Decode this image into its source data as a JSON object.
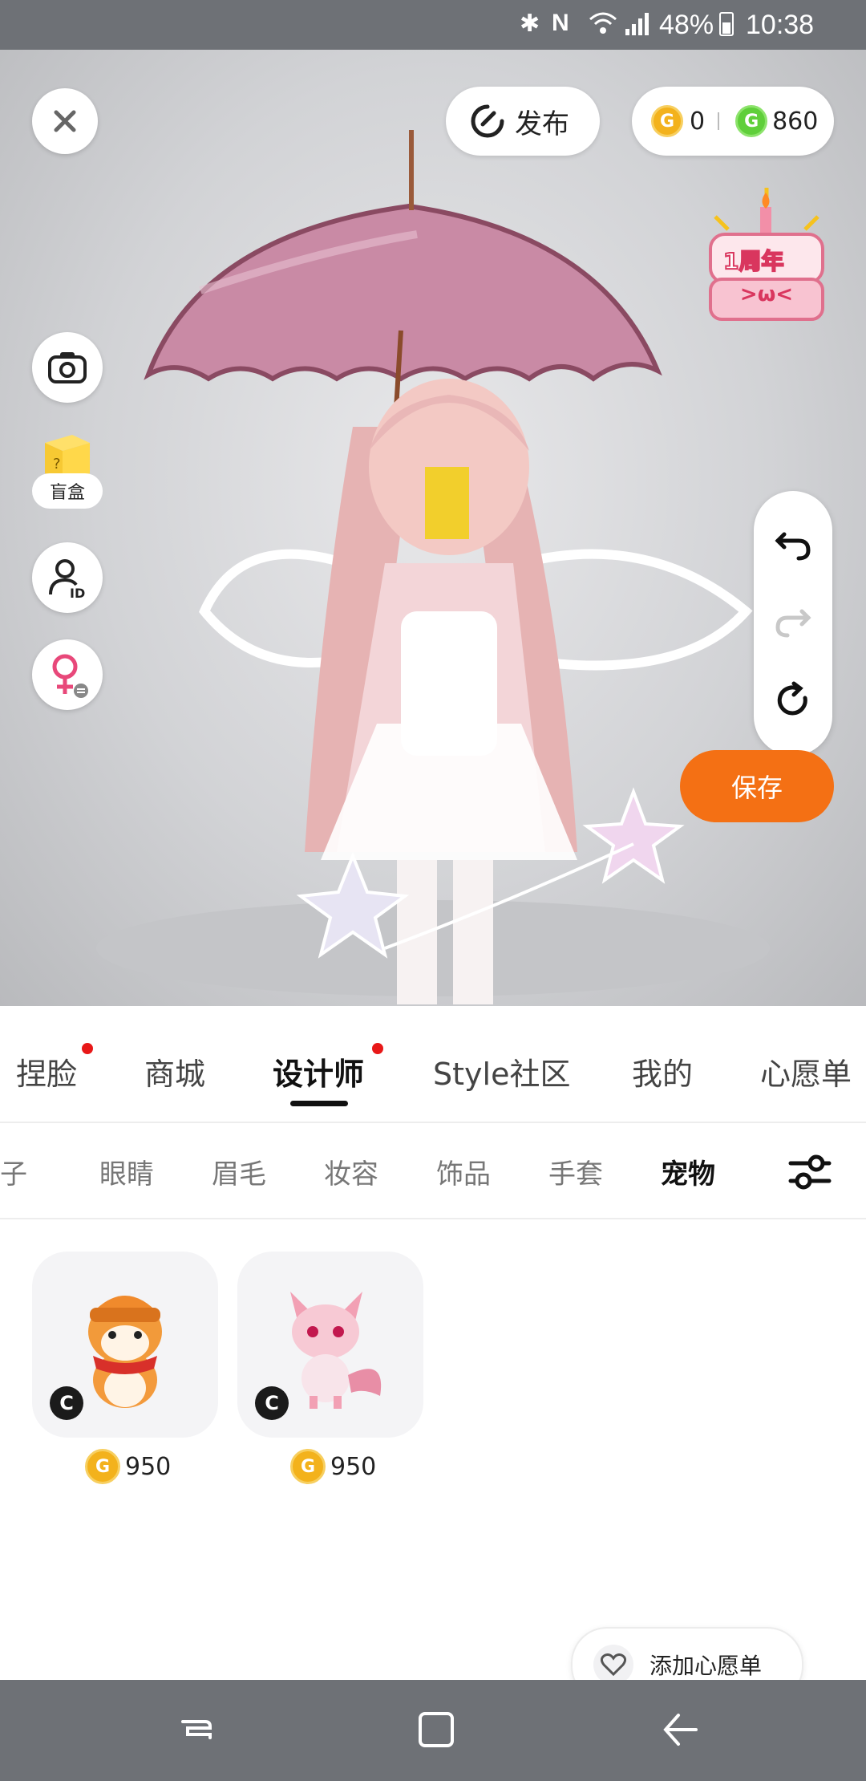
{
  "status_bar": {
    "battery": "48%",
    "time": "10:38"
  },
  "top_bar": {
    "publish_label": "发布",
    "gold_coins": "0",
    "green_coins": "860"
  },
  "side_tools": {
    "blind_box_label": "盲盒"
  },
  "badge": {
    "anniversary_text": "1周年"
  },
  "save_label": "保存",
  "main_tabs": [
    {
      "label": "捏脸",
      "dot": true
    },
    {
      "label": "商城",
      "dot": false
    },
    {
      "label": "设计师",
      "dot": true,
      "active": true
    },
    {
      "label": "Style社区",
      "dot": false
    },
    {
      "label": "我的",
      "dot": false
    },
    {
      "label": "心愿单",
      "dot": false
    }
  ],
  "sub_tabs": [
    {
      "label": "鞋子"
    },
    {
      "label": "眼睛"
    },
    {
      "label": "眉毛"
    },
    {
      "label": "妆容"
    },
    {
      "label": "饰品"
    },
    {
      "label": "手套"
    },
    {
      "label": "宠物",
      "active": true
    }
  ],
  "items": [
    {
      "name": "shiba-pet",
      "price": "950",
      "badge": "C"
    },
    {
      "name": "pink-fox-pet",
      "price": "950",
      "badge": "C"
    }
  ],
  "wishlist_label": "添加心愿单",
  "colors": {
    "accent": "#f47014",
    "gold_coin": "#f3b21c",
    "green_coin": "#5fcf3a",
    "notification_dot": "#e81818"
  }
}
